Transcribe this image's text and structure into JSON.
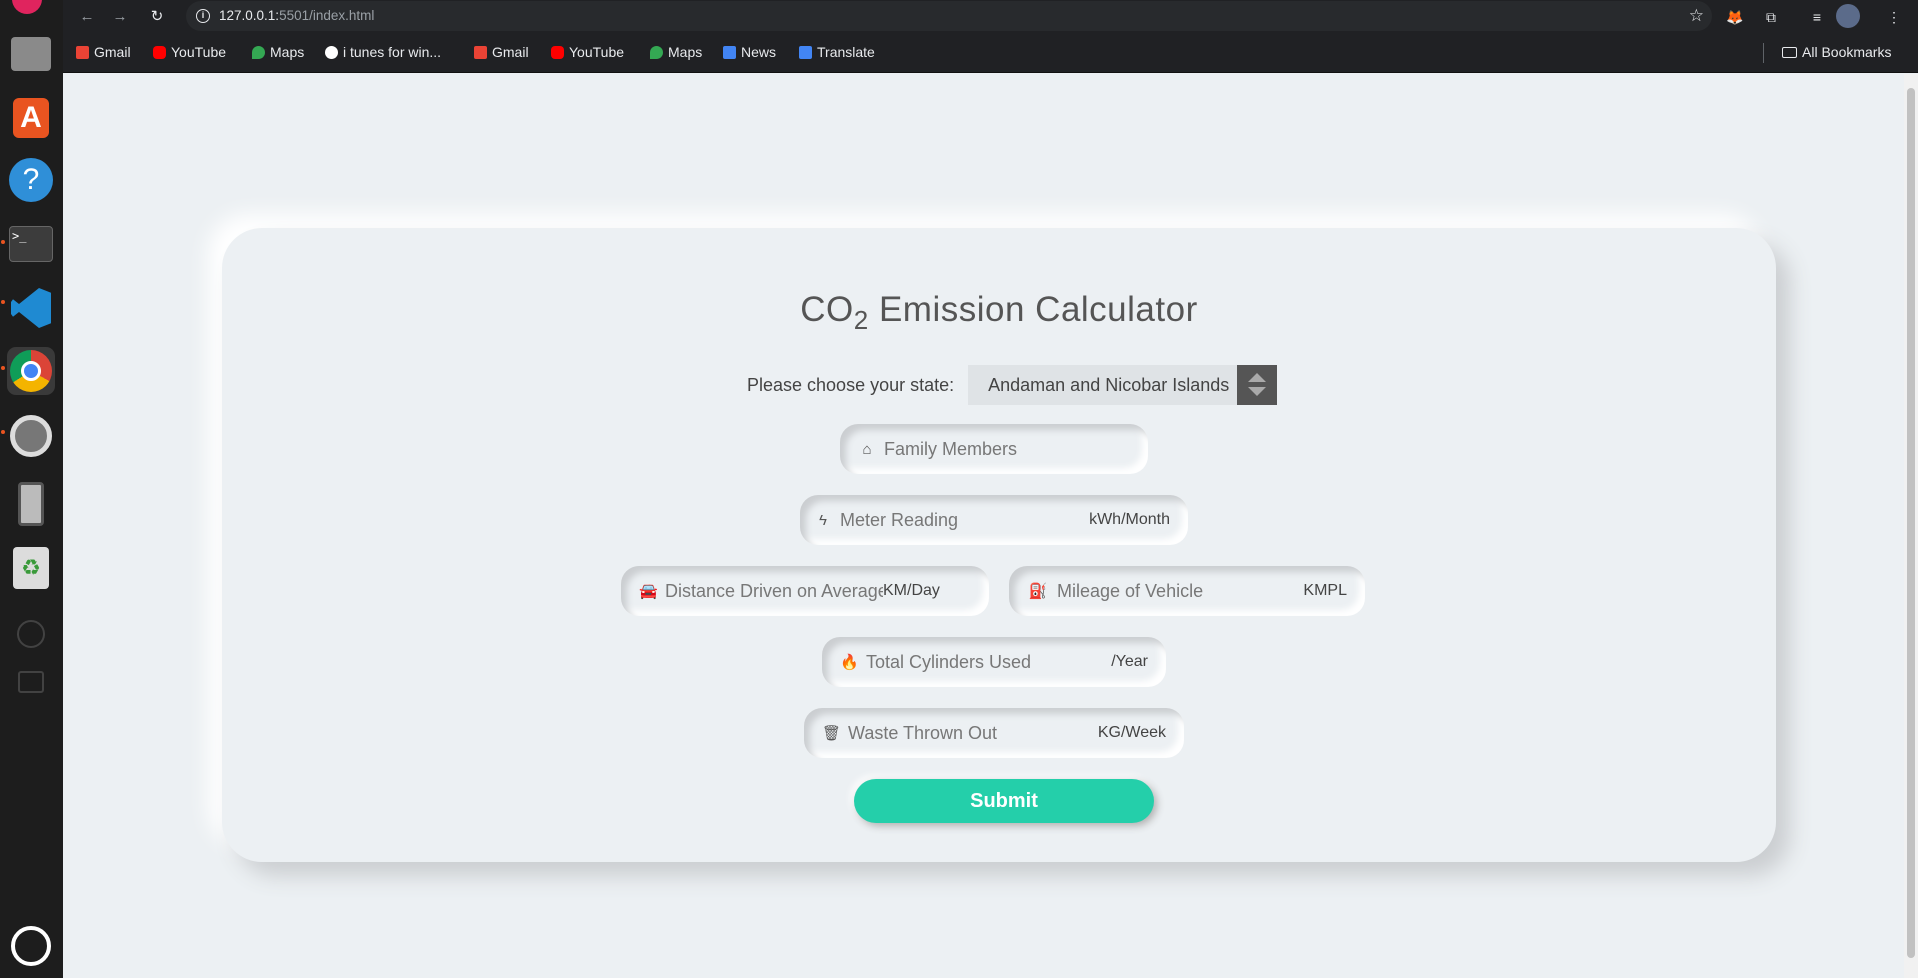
{
  "browser": {
    "url_host": "127.0.0.1:",
    "url_rest": "5501/index.html",
    "bookmarks": [
      "Gmail",
      "YouTube",
      "Maps",
      "i tunes for win...",
      "Gmail",
      "YouTube",
      "Maps",
      "News",
      "Translate"
    ],
    "all_bookmarks": "All Bookmarks"
  },
  "page": {
    "title_main": "CO",
    "title_sub": "2",
    "title_rest": " Emission Calculator",
    "state_label": "Please choose your state:",
    "state_value": "Andaman and Nicobar Islands",
    "fields": {
      "family": {
        "placeholder": "Family Members",
        "unit": ""
      },
      "meter": {
        "placeholder": "Meter Reading",
        "unit": "kWh/Month"
      },
      "distance": {
        "placeholder": "Distance Driven on Average",
        "unit": "KM/Day"
      },
      "mileage": {
        "placeholder": "Mileage of Vehicle",
        "unit": "KMPL"
      },
      "cylinders": {
        "placeholder": "Total Cylinders Used",
        "unit": "/Year"
      },
      "waste": {
        "placeholder": "Waste Thrown Out",
        "unit": "KG/Week"
      }
    },
    "submit_label": "Submit"
  },
  "colors": {
    "accent": "#24cfaa",
    "page_bg": "#ecf0f3"
  }
}
